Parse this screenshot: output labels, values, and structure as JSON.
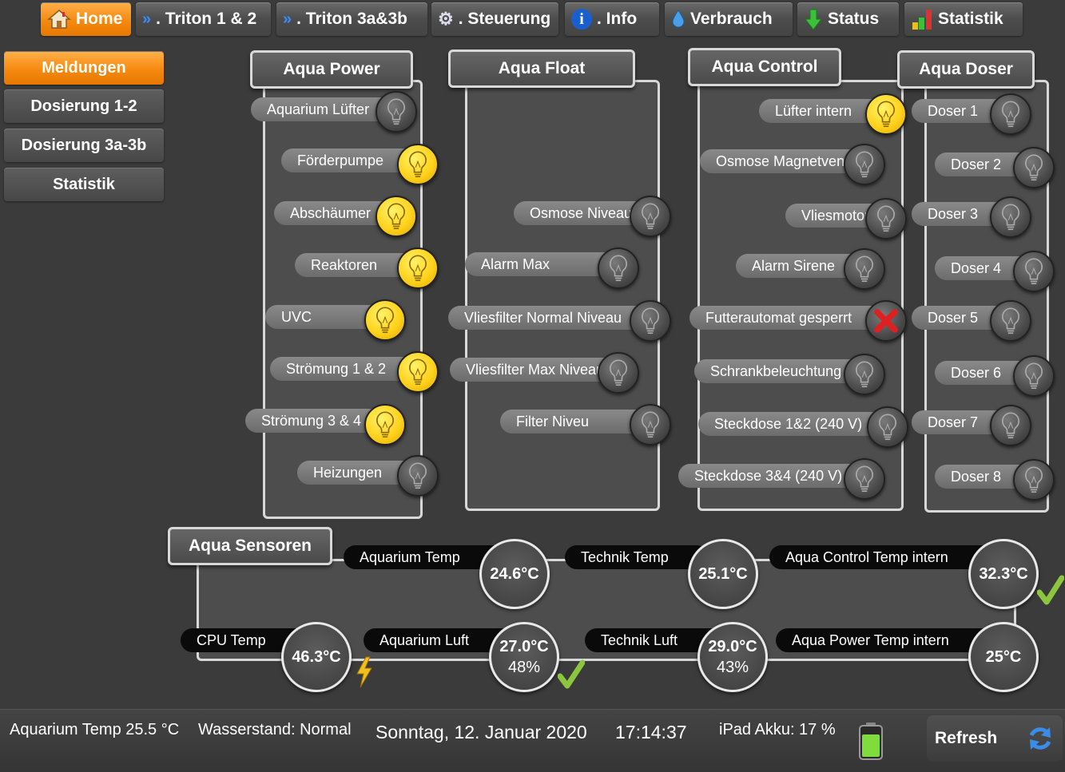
{
  "nav": {
    "home": "Home",
    "triton12": ". Triton 1 & 2",
    "triton3": ". Triton 3a&3b",
    "steuerung": ". Steuerung",
    "info": ". Info",
    "verbrauch": "Verbrauch",
    "status": "Status",
    "statistik": "Statistik"
  },
  "sidebar": {
    "items": [
      "Meldungen",
      "Dosierung 1-2",
      "Dosierung 3a-3b",
      "Statistik"
    ]
  },
  "aqua_power": {
    "title": "Aqua Power",
    "items": [
      {
        "label": "Aquarium Lüfter",
        "state": "off"
      },
      {
        "label": "Förderpumpe",
        "state": "on"
      },
      {
        "label": "Abschäumer",
        "state": "on"
      },
      {
        "label": "Reaktoren",
        "state": "on"
      },
      {
        "label": "UVC",
        "state": "on"
      },
      {
        "label": "Strömung 1 & 2",
        "state": "on"
      },
      {
        "label": "Strömung 3 & 4",
        "state": "on"
      },
      {
        "label": "Heizungen",
        "state": "off"
      }
    ]
  },
  "aqua_float": {
    "title": "Aqua Float",
    "items": [
      {
        "label": "Osmose Niveau",
        "state": "off"
      },
      {
        "label": "Alarm Max",
        "state": "off"
      },
      {
        "label": "Vliesfilter Normal Niveau",
        "state": "off"
      },
      {
        "label": "Vliesfilter Max Niveau",
        "state": "off"
      },
      {
        "label": "Filter Niveu",
        "state": "off"
      }
    ]
  },
  "aqua_control": {
    "title": "Aqua Control",
    "items": [
      {
        "label": "Lüfter intern",
        "state": "on"
      },
      {
        "label": "Osmose Magnetventil",
        "state": "off"
      },
      {
        "label": "Vliesmotor",
        "state": "off"
      },
      {
        "label": "Alarm Sirene",
        "state": "off"
      },
      {
        "label": "Futterautomat gesperrt",
        "state": "error"
      },
      {
        "label": "Schrankbeleuchtung",
        "state": "off"
      },
      {
        "label": "Steckdose 1&2 (240 V)",
        "state": "off"
      },
      {
        "label": "Steckdose 3&4 (240 V)",
        "state": "off"
      }
    ]
  },
  "aqua_doser": {
    "title": "Aqua Doser",
    "items": [
      {
        "label": "Doser 1",
        "state": "off"
      },
      {
        "label": "Doser 2",
        "state": "off"
      },
      {
        "label": "Doser 3",
        "state": "off"
      },
      {
        "label": "Doser 4",
        "state": "off"
      },
      {
        "label": "Doser 5",
        "state": "off"
      },
      {
        "label": "Doser 6",
        "state": "off"
      },
      {
        "label": "Doser 7",
        "state": "off"
      },
      {
        "label": "Doser 8",
        "state": "off"
      }
    ]
  },
  "sensors": {
    "title": "Aqua Sensoren",
    "aquarium_temp": {
      "label": "Aquarium Temp",
      "value": "24.6°C"
    },
    "technik_temp": {
      "label": "Technik Temp",
      "value": "25.1°C"
    },
    "control_temp": {
      "label": "Aqua Control Temp intern",
      "value": "32.3°C"
    },
    "cpu_temp": {
      "label": "CPU Temp",
      "value": "46.3°C"
    },
    "aquarium_luft": {
      "label": "Aquarium Luft",
      "value": "27.0°C",
      "humidity": "48%"
    },
    "technik_luft": {
      "label": "Technik Luft",
      "value": "29.0°C",
      "humidity": "43%"
    },
    "power_temp": {
      "label": "Aqua Power Temp intern",
      "value": "25°C"
    }
  },
  "statusbar": {
    "aquarium_temp": "Aquarium Temp 25.5 °C",
    "wasserstand": "Wasserstand: Normal",
    "date": "Sonntag, 12. Januar 2020",
    "time": "17:14:37",
    "akku": "iPad Akku: 17 %",
    "refresh": "Refresh"
  },
  "colors": {
    "accent": "#f68a10",
    "bulb_on": "#ffd21c",
    "ok": "#8cc63f",
    "error": "#e02020"
  }
}
